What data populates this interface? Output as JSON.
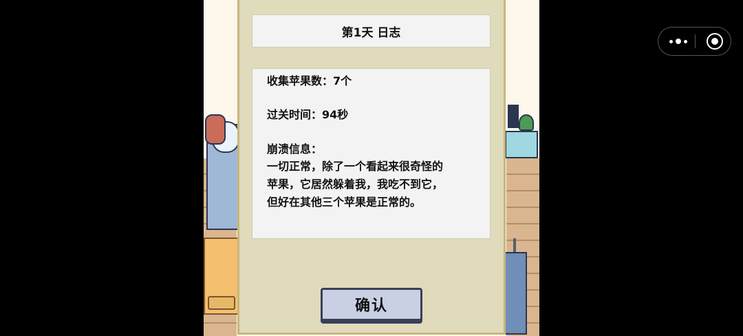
{
  "dialog": {
    "title": "第1天 日志",
    "apples_collected": "收集苹果数：7个",
    "clear_time": "过关时间：94秒",
    "crash_label": "崩溃信息：",
    "crash_lines": [
      "一切正常，除了一个看起来很奇怪的",
      "苹果，它居然躲着我，我吃不到它，",
      "但好在其他三个苹果是正常的。"
    ],
    "confirm_label": "确认"
  },
  "capsule": {
    "more_icon": "more-dots-icon",
    "close_icon": "target-close-icon"
  },
  "colors": {
    "dialog_bg": "#dfdbbb",
    "box_bg": "#f3f3f3",
    "button_bg": "#c9d0e4"
  }
}
